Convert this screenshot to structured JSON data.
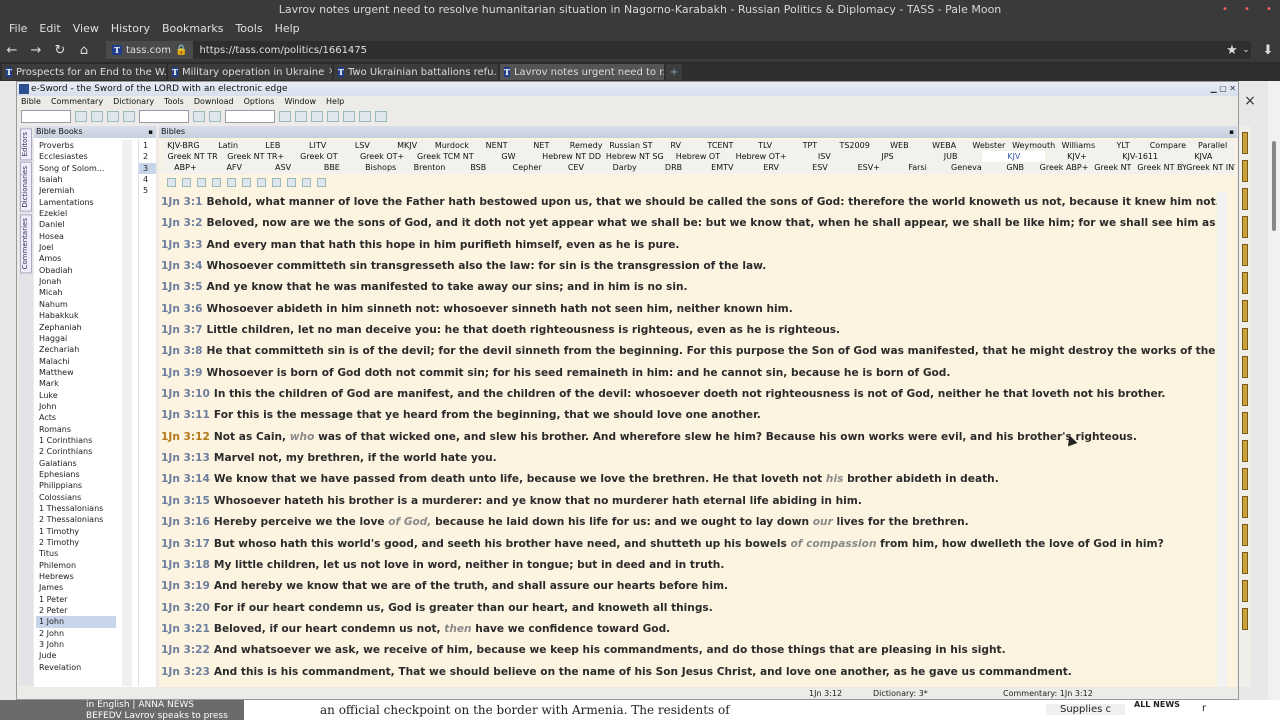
{
  "browser": {
    "window_title": "Lavrov notes urgent need to resolve humanitarian situation in Nagorno-Karabakh - Russian Politics & Diplomacy - TASS - Pale Moon",
    "menu": [
      "File",
      "Edit",
      "View",
      "History",
      "Bookmarks",
      "Tools",
      "Help"
    ],
    "site": "tass.com",
    "url": "https://tass.com/politics/1661475",
    "tabs": [
      {
        "label": "Prospects for an End to the W...",
        "active": false
      },
      {
        "label": "Military operation in Ukraine",
        "active": false
      },
      {
        "label": "Two Ukrainian battalions refu...",
        "active": false
      },
      {
        "label": "Lavrov notes urgent need to r...",
        "active": true
      }
    ],
    "page_close": "×",
    "page_bottom": {
      "left_text_1": "in English | ANNA NEWS",
      "left_text_2": "BEFEDV Lavrov speaks to press",
      "article": "an official checkpoint on the border with Armenia. The residents of",
      "supplies": "Supplies c",
      "allnews": "ALL NEWS",
      "edge": "r"
    }
  },
  "esword": {
    "title": "e-Sword - the Sword of the LORD with an electronic edge",
    "menu": [
      "Bible",
      "Commentary",
      "Dictionary",
      "Tools",
      "Download",
      "Options",
      "Window",
      "Help"
    ],
    "side_tabs": [
      "Editors",
      "Dictionaries",
      "Commentaries"
    ],
    "books_header": "Bible Books",
    "bible_header": "Bibles",
    "books": [
      "Proverbs",
      "Ecclesiastes",
      "Song of Solom...",
      "Isaiah",
      "Jeremiah",
      "Lamentations",
      "Ezekiel",
      "Daniel",
      "Hosea",
      "Joel",
      "Amos",
      "Obadiah",
      "Jonah",
      "Micah",
      "Nahum",
      "Habakkuk",
      "Zephaniah",
      "Haggai",
      "Zechariah",
      "Malachi",
      "Matthew",
      "Mark",
      "Luke",
      "John",
      "Acts",
      "Romans",
      "1 Corinthians",
      "2 Corinthians",
      "Galatians",
      "Ephesians",
      "Philippians",
      "Colossians",
      "1 Thessalonians",
      "2 Thessalonians",
      "1 Timothy",
      "2 Timothy",
      "Titus",
      "Philemon",
      "Hebrews",
      "James",
      "1 Peter",
      "2 Peter",
      "1 John",
      "2 John",
      "3 John",
      "Jude",
      "Revelation"
    ],
    "selected_book": "1 John",
    "chapters": [
      "1",
      "2",
      "3",
      "4",
      "5"
    ],
    "selected_chapter": "3",
    "version_rows": [
      [
        "KJV-BRG",
        "Latin",
        "LEB",
        "LITV",
        "LSV",
        "MKJV",
        "Murdock",
        "NENT",
        "NET",
        "Remedy",
        "Russian ST",
        "RV",
        "TCENT",
        "TLV",
        "TPT",
        "TS2009",
        "WEB",
        "WEBA",
        "Webster",
        "Weymouth",
        "Williams",
        "YLT",
        "Compare",
        "Parallel"
      ],
      [
        "Greek NT TR",
        "Greek NT TR+",
        "Greek OT",
        "Greek OT+",
        "Greek TCM NT",
        "GW",
        "Hebrew NT DD",
        "Hebrew NT SG",
        "Hebrew OT",
        "Hebrew OT+",
        "ISV",
        "JPS",
        "JUB",
        "KJV",
        "KJV+",
        "KJV-1611",
        "KJVA"
      ],
      [
        "ABP+",
        "AFV",
        "ASV",
        "BBE",
        "Bishops",
        "Brenton",
        "BSB",
        "Cepher",
        "CEV",
        "Darby",
        "DRB",
        "EMTV",
        "ERV",
        "ESV",
        "ESV+",
        "Farsi",
        "Geneva",
        "GNB",
        "Greek ABP+",
        "Greek NT",
        "Greek NT BYZ+",
        "Greek NT INT+"
      ]
    ],
    "active_version": "KJV",
    "verses": [
      {
        "ref": "1Jn 3:1",
        "parts": [
          {
            "t": "Behold, what manner of love the Father hath bestowed upon us, that we should be called the sons of God: therefore the world knoweth us not, because it knew him not."
          }
        ]
      },
      {
        "ref": "1Jn 3:2",
        "parts": [
          {
            "t": "Beloved, now are we the sons of God, and it doth not yet appear what we shall be: but we know that, when he shall appear, we shall be like him; for we shall see him as he is."
          }
        ]
      },
      {
        "ref": "1Jn 3:3",
        "parts": [
          {
            "t": "And every man that hath this hope in him purifieth himself, even as he is pure."
          }
        ]
      },
      {
        "ref": "1Jn 3:4",
        "parts": [
          {
            "t": "Whosoever committeth sin transgresseth also the law: for sin is the transgression of the law."
          }
        ]
      },
      {
        "ref": "1Jn 3:5",
        "parts": [
          {
            "t": "And ye know that he was manifested to take away our sins; and in him is no sin."
          }
        ]
      },
      {
        "ref": "1Jn 3:6",
        "parts": [
          {
            "t": "Whosoever abideth in him sinneth not: whosoever sinneth hath not seen him, neither known him."
          }
        ]
      },
      {
        "ref": "1Jn 3:7",
        "parts": [
          {
            "t": "Little children, let no man deceive you: he that doeth righteousness is righteous, even as he is righteous."
          }
        ]
      },
      {
        "ref": "1Jn 3:8",
        "parts": [
          {
            "t": "He that committeth sin is of the devil; for the devil sinneth from the beginning. For this purpose the Son of God was manifested, that he might destroy the works of the devil."
          }
        ]
      },
      {
        "ref": "1Jn 3:9",
        "parts": [
          {
            "t": "Whosoever is born of God doth not commit sin; for his seed remaineth in him: and he cannot sin, because he is born of God."
          }
        ]
      },
      {
        "ref": "1Jn 3:10",
        "parts": [
          {
            "t": "In this the children of God are manifest, and the children of the devil: whosoever doeth not righteousness is not of God, neither he that loveth not his brother."
          }
        ]
      },
      {
        "ref": "1Jn 3:11",
        "parts": [
          {
            "t": "For this is the message that ye heard from the beginning, that we should love one another."
          }
        ]
      },
      {
        "ref": "1Jn 3:12",
        "current": true,
        "parts": [
          {
            "t": "Not as Cain, "
          },
          {
            "t": "who",
            "i": true
          },
          {
            "t": " was of that wicked one, and slew his brother. And wherefore slew he him? Because his own works were evil, and his brother's righteous."
          }
        ]
      },
      {
        "ref": "1Jn 3:13",
        "parts": [
          {
            "t": "Marvel not, my brethren, if the world hate you."
          }
        ]
      },
      {
        "ref": "1Jn 3:14",
        "parts": [
          {
            "t": "We know that we have passed from death unto life, because we love the brethren. He that loveth not "
          },
          {
            "t": "his",
            "i": true
          },
          {
            "t": " brother abideth in death."
          }
        ]
      },
      {
        "ref": "1Jn 3:15",
        "parts": [
          {
            "t": "Whosoever hateth his brother is a murderer: and ye know that no murderer hath eternal life abiding in him."
          }
        ]
      },
      {
        "ref": "1Jn 3:16",
        "parts": [
          {
            "t": "Hereby perceive we the love "
          },
          {
            "t": "of God,",
            "i": true
          },
          {
            "t": " because he laid down his life for us: and we ought to lay down "
          },
          {
            "t": "our",
            "i": true
          },
          {
            "t": " lives for the brethren."
          }
        ]
      },
      {
        "ref": "1Jn 3:17",
        "parts": [
          {
            "t": "But whoso hath this world's good, and seeth his brother have need, and shutteth up his bowels "
          },
          {
            "t": "of compassion",
            "i": true
          },
          {
            "t": " from him, how dwelleth the love of God in him?"
          }
        ]
      },
      {
        "ref": "1Jn 3:18",
        "parts": [
          {
            "t": "My little children, let us not love in word, neither in tongue; but in deed and in truth."
          }
        ]
      },
      {
        "ref": "1Jn 3:19",
        "parts": [
          {
            "t": "And hereby we know that we are of the truth, and shall assure our hearts before him."
          }
        ]
      },
      {
        "ref": "1Jn 3:20",
        "parts": [
          {
            "t": "For if our heart condemn us, God is greater than our heart, and knoweth all things."
          }
        ]
      },
      {
        "ref": "1Jn 3:21",
        "parts": [
          {
            "t": "Beloved, if our heart condemn us not, "
          },
          {
            "t": "then",
            "i": true
          },
          {
            "t": " have we confidence toward God."
          }
        ]
      },
      {
        "ref": "1Jn 3:22",
        "parts": [
          {
            "t": "And whatsoever we ask, we receive of him, because we keep his commandments, and do those things that are pleasing in his sight."
          }
        ]
      },
      {
        "ref": "1Jn 3:23",
        "parts": [
          {
            "t": "And this is his commandment, That we should believe on the name of his Son Jesus Christ, and love one another, as he gave us commandment."
          }
        ]
      }
    ],
    "status": {
      "ref": "1Jn 3:12",
      "dictionary": "Dictionary: 3*",
      "commentary": "Commentary: 1Jn 3:12"
    }
  }
}
